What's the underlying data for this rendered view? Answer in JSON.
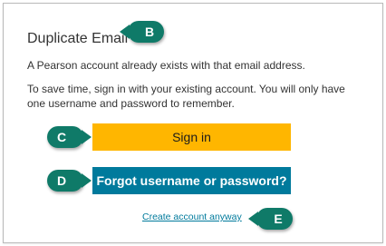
{
  "dialog": {
    "title": "Duplicate Email",
    "message_line1": "A Pearson account already exists with that email address.",
    "message_line2": "To save time, sign in with your existing account. You will only have one username and password to remember."
  },
  "buttons": {
    "sign_in": "Sign in",
    "forgot": "Forgot username or password?"
  },
  "links": {
    "create_account": "Create account anyway"
  },
  "callouts": {
    "b": "B",
    "c": "C",
    "d": "D",
    "e": "E"
  },
  "colors": {
    "sign_in_button": "#ffb600",
    "forgot_button": "#007a9c",
    "link": "#007a9c",
    "callout": "#0f7a68"
  }
}
